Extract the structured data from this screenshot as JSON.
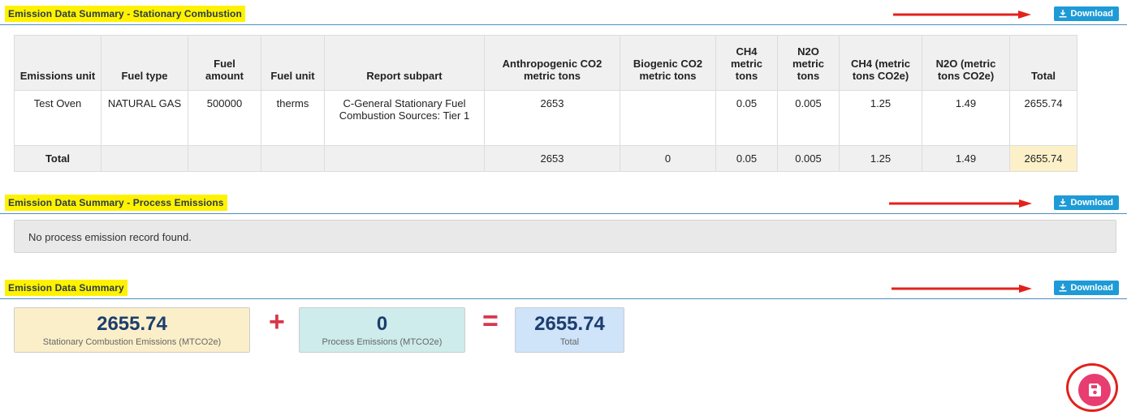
{
  "sections": {
    "stationary": {
      "title": "Emission Data Summary - Stationary Combustion",
      "download_label": "Download"
    },
    "process": {
      "title": "Emission Data Summary - Process Emissions",
      "download_label": "Download",
      "empty_message": "No process emission record found."
    },
    "summary": {
      "title": "Emission Data Summary",
      "download_label": "Download"
    }
  },
  "table": {
    "headers": [
      "Emissions unit",
      "Fuel type",
      "Fuel amount",
      "Fuel unit",
      "Report subpart",
      "Anthropogenic CO2 metric tons",
      "Biogenic CO2 metric tons",
      "CH4 metric tons",
      "N2O metric tons",
      "CH4 (metric tons CO2e)",
      "N2O (metric tons CO2e)",
      "Total"
    ],
    "rows": [
      [
        "Test Oven",
        "NATURAL GAS",
        "500000",
        "therms",
        "C-General Stationary Fuel Combustion Sources: Tier 1",
        "2653",
        "",
        "0.05",
        "0.005",
        "1.25",
        "1.49",
        "2655.74"
      ]
    ],
    "total_row": [
      "Total",
      "",
      "",
      "",
      "",
      "2653",
      "0",
      "0.05",
      "0.005",
      "1.25",
      "1.49",
      "2655.74"
    ]
  },
  "summary_cards": {
    "stationary": {
      "value": "2655.74",
      "label": "Stationary Combustion Emissions (MTCO2e)",
      "color": "#fbefc9"
    },
    "process": {
      "value": "0",
      "label": "Process Emissions (MTCO2e)",
      "color": "#cdeceb"
    },
    "total": {
      "value": "2655.74",
      "label": "Total",
      "color": "#cfe3f9"
    },
    "plus_symbol": "+",
    "equals_symbol": "="
  },
  "icons": {
    "download": "download-icon",
    "save": "save-icon",
    "annotation_arrow": "red-arrow"
  },
  "colors": {
    "accent": "#1e9bd7",
    "highlight": "#fff200",
    "annotation": "#e3211b",
    "save_button": "#e83d70"
  }
}
